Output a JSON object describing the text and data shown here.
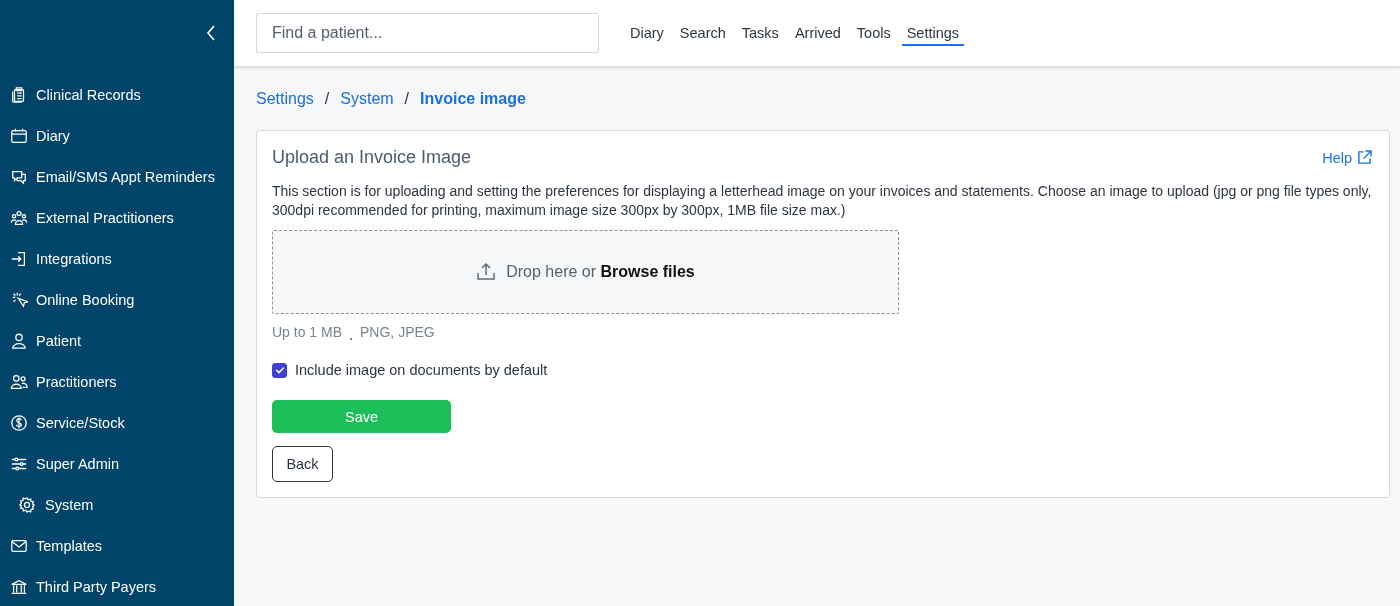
{
  "sidebar": {
    "items": [
      {
        "label": "Clinical Records"
      },
      {
        "label": "Diary"
      },
      {
        "label": "Email/SMS Appt Reminders"
      },
      {
        "label": "External Practitioners"
      },
      {
        "label": "Integrations"
      },
      {
        "label": "Online Booking"
      },
      {
        "label": "Patient"
      },
      {
        "label": "Practitioners"
      },
      {
        "label": "Service/Stock"
      },
      {
        "label": "Super Admin",
        "children": [
          {
            "label": "System"
          }
        ]
      },
      {
        "label": "Templates"
      },
      {
        "label": "Third Party Payers"
      }
    ]
  },
  "search": {
    "placeholder": "Find a patient..."
  },
  "nav": [
    {
      "label": "Diary",
      "selected": false
    },
    {
      "label": "Search",
      "selected": false
    },
    {
      "label": "Tasks",
      "selected": false
    },
    {
      "label": "Arrived",
      "selected": false
    },
    {
      "label": "Tools",
      "selected": false
    },
    {
      "label": "Settings",
      "selected": true
    }
  ],
  "breadcrumb": [
    {
      "label": "Settings",
      "current": false
    },
    {
      "separator": "/",
      "label": "System",
      "current": false
    },
    {
      "separator": "/",
      "label": "Invoice image",
      "current": true
    }
  ],
  "card": {
    "title": "Upload an Invoice Image",
    "help": "Help",
    "description": "This section is for uploading and setting the preferences for displaying a letterhead image on your invoices and statements. Choose an image to upload (jpg or png file types only, 300dpi recommended for printing, maximum image size 300px by 300px, 1MB file size max.)",
    "dropzone": "Drop here or **Browse files**",
    "limits": [
      "Up to 1 MB",
      "PNG, JPEG"
    ],
    "checkbox": {
      "label": "Include image on documents by default",
      "checked": true
    },
    "buttons": [
      {
        "label": "Save",
        "kind": "primary"
      },
      {
        "label": "Back",
        "kind": "secondary"
      }
    ]
  }
}
